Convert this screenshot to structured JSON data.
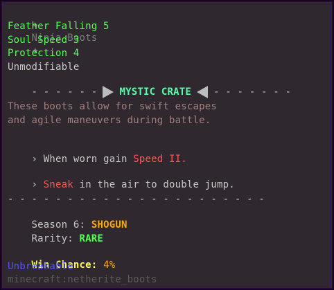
{
  "item": {
    "name": "Ninja Boots",
    "title_icon_left": "star-icon",
    "title_icon_right": "star-icon"
  },
  "enchantments": [
    "Feather Falling 5",
    "Soul Speed 3",
    "Protection 4"
  ],
  "modifiable_status": "Unmodifiable",
  "crate": {
    "left_dashes": "- - - - - -",
    "label": "MYSTIC CRATE",
    "right_dashes": "- - - - - - -"
  },
  "lore": [
    "These boots allow for swift escapes",
    "and agile maneuvers during battle."
  ],
  "abilities": [
    {
      "prefix": "› When worn gain ",
      "highlight": "Speed II.",
      "suffix": ""
    },
    {
      "prefix": "› ",
      "highlight": "Sneak",
      "suffix": " in the air to double jump."
    }
  ],
  "divider": "- - - - - - - - - - - - - - - - - - - - - -",
  "season": {
    "label": "Season 6: ",
    "value": "SHOGUN"
  },
  "rarity": {
    "label": "Rarity: ",
    "value": "RARE"
  },
  "win_chance": {
    "label": "Win Chance: ",
    "value": "4%"
  },
  "unbreakable": "Unbreakable",
  "item_id": "minecraft:netherite_boots",
  "colors": {
    "enchant_green": "#55ff55",
    "highlight_red": "#ff5555",
    "shogun_gold": "#ffaa00",
    "rare_green": "#55ff55",
    "win_yellow": "#ffff55",
    "unbreakable_blue": "#5555ff",
    "border_purple": "#24093a"
  }
}
